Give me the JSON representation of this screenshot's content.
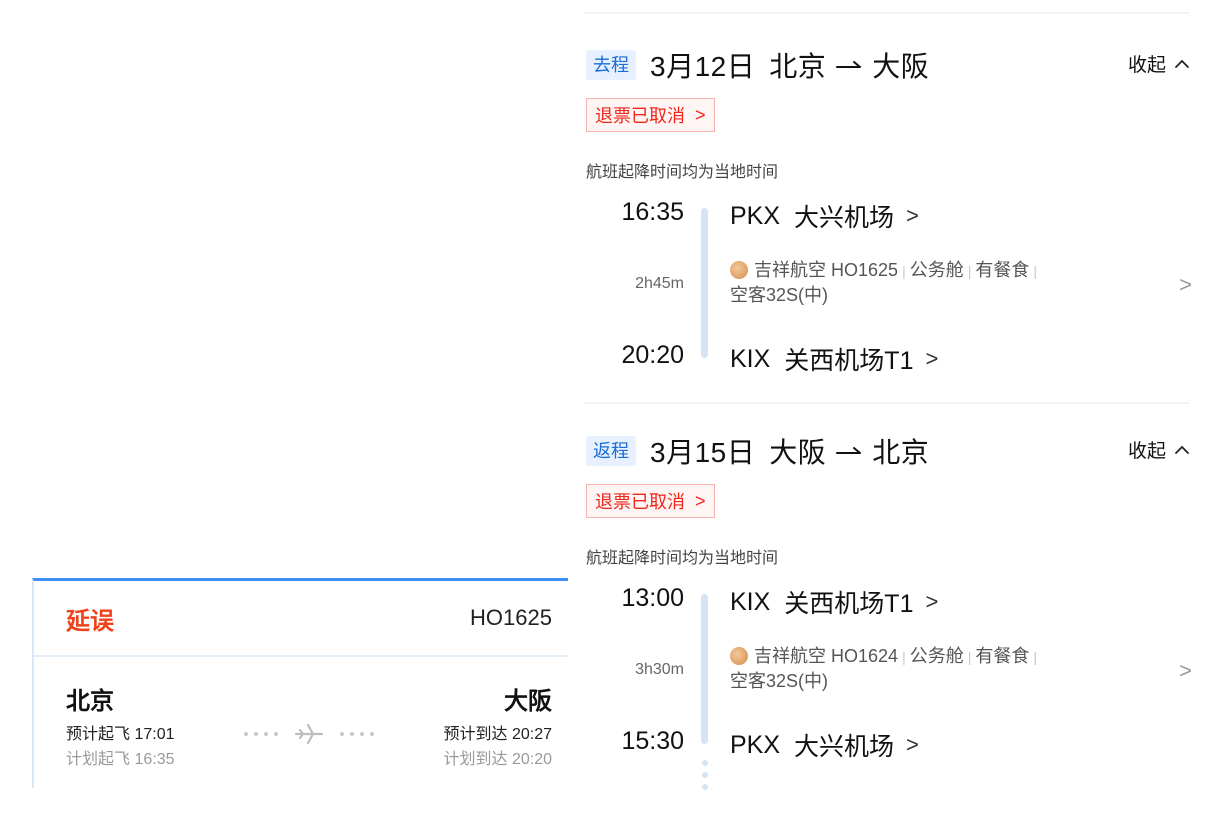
{
  "status_card": {
    "status": "延误",
    "flight_no": "HO1625",
    "departure": {
      "city": "北京",
      "estimated": "预计起飞 17:01",
      "planned": "计划起飞 16:35"
    },
    "arrival": {
      "city": "大阪",
      "estimated": "预计到达 20:27",
      "planned": "计划到达 20:20"
    },
    "route_icon": "plane-icon"
  },
  "itinerary": {
    "collapse_label": "收起",
    "segments": [
      {
        "tag": "去程",
        "date": "3月12日",
        "from_city": "北京",
        "to_city": "大阪",
        "refund_status": "退票已取消",
        "local_time_note": "航班起降时间均为当地时间",
        "departure": {
          "time": "16:35",
          "code": "PKX",
          "airport": "大兴机场"
        },
        "duration": "2h45m",
        "flight": {
          "airline": "吉祥航空",
          "number": "HO1625",
          "cabin": "公务舱",
          "meal": "有餐食",
          "aircraft": "空客32S(中)"
        },
        "arrival": {
          "time": "20:20",
          "code": "KIX",
          "airport": "关西机场T1"
        }
      },
      {
        "tag": "返程",
        "date": "3月15日",
        "from_city": "大阪",
        "to_city": "北京",
        "refund_status": "退票已取消",
        "local_time_note": "航班起降时间均为当地时间",
        "departure": {
          "time": "13:00",
          "code": "KIX",
          "airport": "关西机场T1"
        },
        "duration": "3h30m",
        "flight": {
          "airline": "吉祥航空",
          "number": "HO1624",
          "cabin": "公务舱",
          "meal": "有餐食",
          "aircraft": "空客32S(中)"
        },
        "arrival": {
          "time": "15:30",
          "code": "PKX",
          "airport": "大兴机场"
        }
      }
    ]
  },
  "colors": {
    "delay_red": "#f0421a",
    "accent_blue": "#1a6dd8",
    "tag_bg": "#e6f0ff",
    "refund_red": "#f0261a",
    "timeline": "#d5e3f5"
  }
}
